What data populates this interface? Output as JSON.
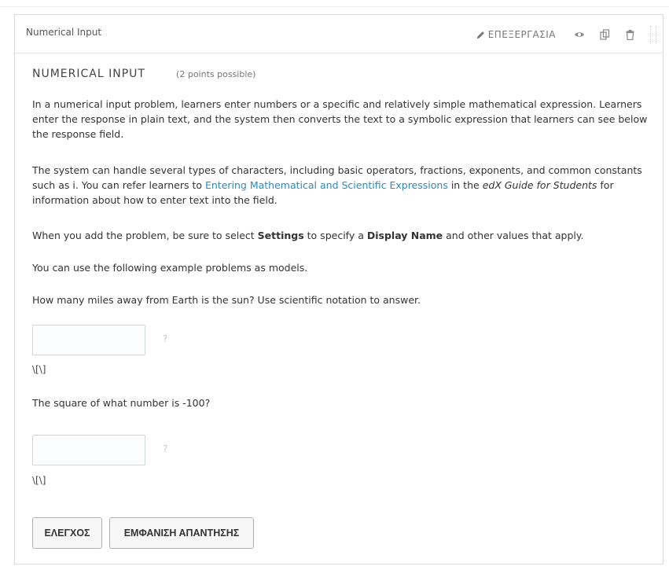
{
  "block": {
    "header_title": "Numerical Input",
    "edit_label": "ΕΠΕΞΕΡΓΑΣΙΑ",
    "icons": [
      "pencil-icon",
      "eye-icon",
      "duplicate-icon",
      "trash-icon",
      "drag-handle-icon"
    ]
  },
  "problem": {
    "title": "NUMERICAL INPUT",
    "points": "(2 points possible)",
    "para1": "In a numerical input problem, learners enter numbers or a specific and relatively simple mathematical expression. Learners enter the response in plain text, and the system then converts the text to a symbolic expression that learners can see below the response field.",
    "para2_a": "The system can handle several types of characters, including basic operators, fractions, exponents, and common constants such as i. You can refer learners to ",
    "para2_link": "Entering Mathematical and Scientific Expressions",
    "para2_b": " in the ",
    "para2_em": "edX Guide for Students",
    "para2_c": " for information about how to enter text into the field.",
    "para3_a": "When you add the problem, be sure to select ",
    "para3_b1": "Settings",
    "para3_c": " to specify a ",
    "para3_b2": "Display Name",
    "para3_d": " and other values that apply.",
    "para4": "You can use the following example problems as models.",
    "question1": "How many miles away from Earth is the sun? Use scientific notation to answer.",
    "question2": "The square of what number is -100?",
    "input1_value": "",
    "input2_value": "",
    "help_mark": "?",
    "preview1": "\\[\\]",
    "preview2": "\\[\\]"
  },
  "actions": {
    "check_label": "ΕΛΕΓΧΟΣ",
    "show_answer_label": "ΕΜΦΑΝΙΣΗ ΑΠΑΝΤΗΣΗΣ"
  },
  "colors": {
    "link": "#2a8bbf",
    "border": "#dcdcdc"
  }
}
